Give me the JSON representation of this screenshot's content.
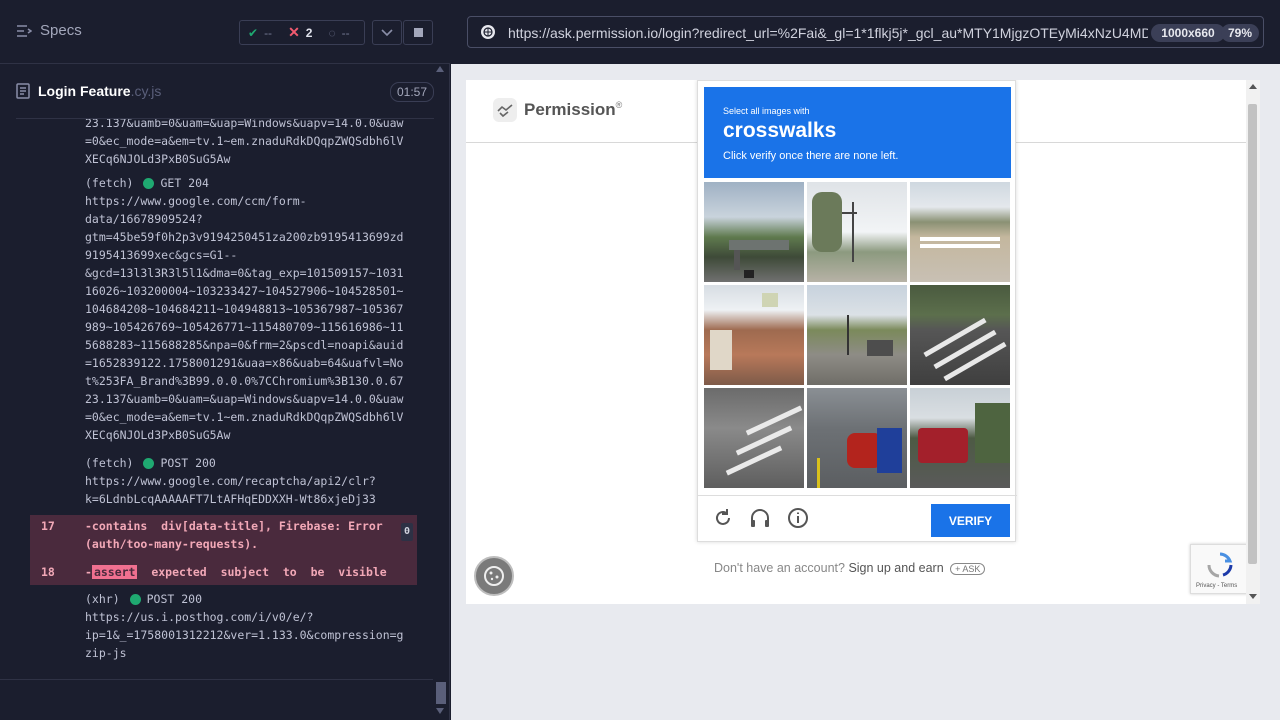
{
  "reporter": {
    "specs_label": "Specs",
    "stats": {
      "passed": "--",
      "failed": "2",
      "pending": "--"
    },
    "spec": {
      "name": "Login Feature",
      "ext": ".cy.js",
      "duration": "01:57"
    }
  },
  "log": {
    "block0": [
      "23.137&uamb=0&uam=&uap=Windows&uapv=14.0.0&uaw",
      "=0&ec_mode=a&em=tv.1~em.znaduRdkDQqpZWQSdbh6lV",
      "XECq6NJOLd3PxB0SuG5Aw"
    ],
    "fetch1": {
      "kind": "(fetch)",
      "method": "GET 204",
      "lines": [
        "https://www.google.com/ccm/form-",
        "data/16678909524?",
        "gtm=45be59f0h2p3v9194250451za200zb9195413699zd",
        "9195413699xec&gcs=G1--",
        "&gcd=13l3l3R3l5l1&dma=0&tag_exp=101509157~1031",
        "16026~103200004~103233427~104527906~104528501~",
        "104684208~104684211~104948813~105367987~105367",
        "989~105426769~105426771~115480709~115616986~11",
        "5688283~115688285&npa=0&frm=2&pscdl=noapi&auid",
        "=1652839122.1758001291&uaa=x86&uab=64&uafvl=No",
        "t%253FA_Brand%3B99.0.0.0%7CChromium%3B130.0.67",
        "23.137&uamb=0&uam=&uap=Windows&uapv=14.0.0&uaw",
        "=0&ec_mode=a&em=tv.1~em.znaduRdkDQqpZWQSdbh6lV",
        "XECq6NJOLd3PxB0SuG5Aw"
      ]
    },
    "fetch2": {
      "kind": "(fetch)",
      "method": "POST 200",
      "lines": [
        "https://www.google.com/recaptcha/api2/clr?",
        "k=6LdnbLcqAAAAAFT7LtAFHqEDDXXH-Wt86xjeDj33"
      ]
    },
    "error17": {
      "num": "17",
      "line1": "-contains  div[data-title], Firebase: Error",
      "line2": "(auth/too-many-requests).",
      "badge": "0"
    },
    "error18": {
      "num": "18",
      "prefix": "-",
      "assert": "assert",
      "rest": "  expected  subject  to  be  visible"
    },
    "xhr": {
      "kind": "(xhr)",
      "method": "POST 200",
      "lines": [
        "https://us.i.posthog.com/i/v0/e/?",
        "ip=1&_=1758001312212&ver=1.133.0&compression=g",
        "zip-js"
      ]
    }
  },
  "browser": {
    "url": "https://ask.permission.io/login?redirect_url=%2Fai&_gl=1*1flkj5j*_gcl_au*MTY1MjgzOTEyMi4xNzU4MD",
    "viewport": "1000x660",
    "zoom": "79%"
  },
  "page": {
    "logo": "Permission",
    "logo_mark": "®",
    "footer_q": "Don't have an account?",
    "footer_link": "Sign up and earn",
    "footer_chip": "+ ASK"
  },
  "captcha": {
    "header_small": "Select all images with",
    "header_big": "crosswalks",
    "header_sub": "Click verify once there are none left.",
    "verify": "VERIFY",
    "recaptcha_terms": "Privacy - Terms"
  }
}
